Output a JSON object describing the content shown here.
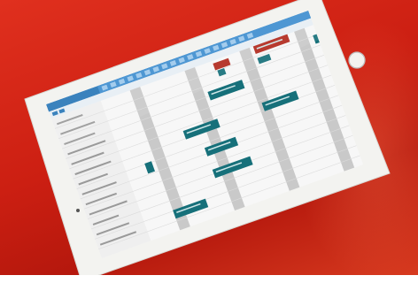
{
  "scene": {
    "background_color": "#d3281a",
    "device": "tablet",
    "device_color": "#f4f4f2"
  },
  "app": {
    "header_color": "#2a78b8",
    "tab_color": "#3f8fd0",
    "schedule_block_color": "#16707a",
    "alert_block_color": "#b12a1e",
    "column_stripe_color": "#c9c9c9"
  }
}
